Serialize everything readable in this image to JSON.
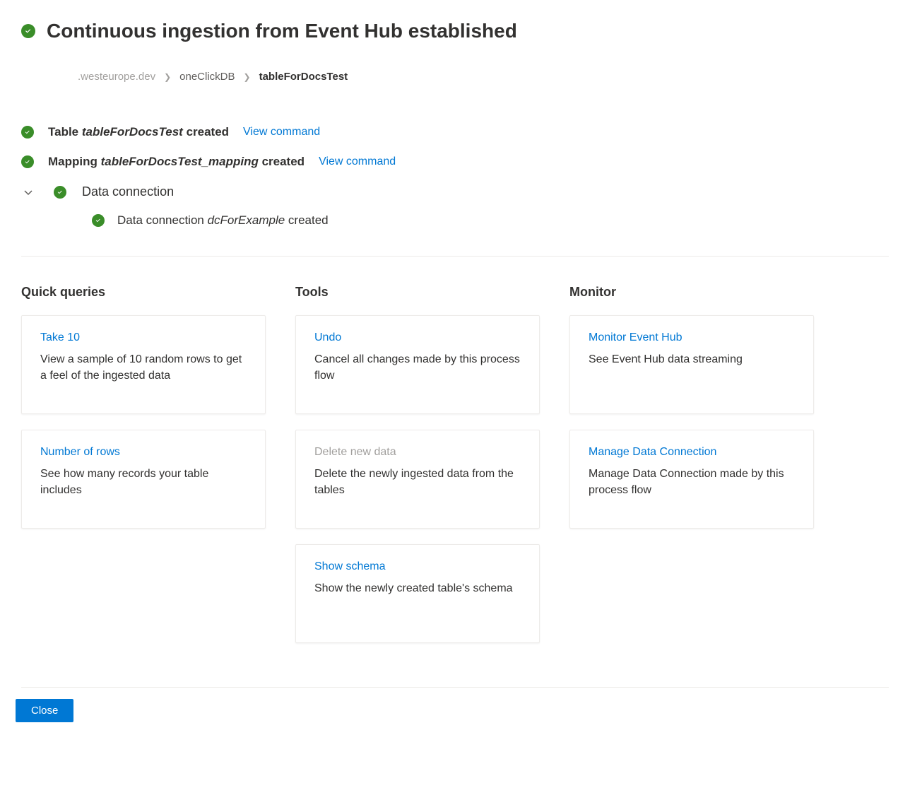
{
  "header": {
    "title": "Continuous ingestion from Event Hub established"
  },
  "breadcrumb": {
    "cluster": ".westeurope.dev",
    "database": "oneClickDB",
    "table": "tableForDocsTest"
  },
  "results": {
    "table_line_prefix": "Table ",
    "table_name": "tableForDocsTest",
    "table_line_suffix": " created",
    "mapping_line_prefix": "Mapping ",
    "mapping_name": "tableForDocsTest_mapping",
    "mapping_line_suffix": " created",
    "view_command_label": "View command",
    "data_connection_heading": "Data connection",
    "dc_line_prefix": "Data connection ",
    "dc_name": "dcForExample",
    "dc_line_suffix": " created"
  },
  "columns": {
    "quick_queries": {
      "title": "Quick queries",
      "cards": [
        {
          "link": "Take 10",
          "desc": "View a sample of 10 random rows to get a feel of the ingested data",
          "disabled": false
        },
        {
          "link": "Number of rows",
          "desc": "See how many records your table includes",
          "disabled": false
        }
      ]
    },
    "tools": {
      "title": "Tools",
      "cards": [
        {
          "link": "Undo",
          "desc": "Cancel all changes made by this process flow",
          "disabled": false
        },
        {
          "link": "Delete new data",
          "desc": "Delete the newly ingested data from the tables",
          "disabled": true
        },
        {
          "link": "Show schema",
          "desc": "Show the newly created table's schema",
          "disabled": false
        }
      ]
    },
    "monitor": {
      "title": "Monitor",
      "cards": [
        {
          "link": "Monitor Event Hub",
          "desc": "See Event Hub data streaming",
          "disabled": false
        },
        {
          "link": "Manage Data Connection",
          "desc": "Manage Data Connection made by this process flow",
          "disabled": false
        }
      ]
    }
  },
  "footer": {
    "close_label": "Close"
  }
}
